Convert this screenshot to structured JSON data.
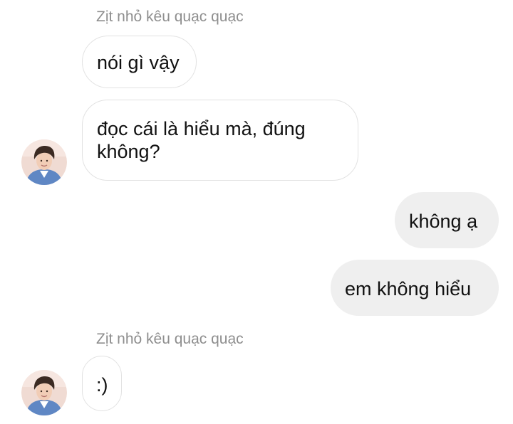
{
  "messages": [
    {
      "type": "sender",
      "text": "Zịt nhỏ kêu quạc quạc"
    },
    {
      "type": "incoming",
      "text": "nói gì vậy"
    },
    {
      "type": "incoming",
      "lines": [
        "đọc cái là hiểu mà, đúng",
        "không?"
      ],
      "avatar": "user-avatar-photo"
    },
    {
      "type": "outgoing",
      "text": "không ạ"
    },
    {
      "type": "outgoing",
      "text": "em không hiểu"
    },
    {
      "type": "sender",
      "text": "Zịt nhỏ kêu quạc quạc"
    },
    {
      "type": "incoming",
      "text": ":)",
      "avatar": "user-avatar-photo"
    }
  ],
  "colors": {
    "incoming_bubble_bg": "#ffffff",
    "incoming_bubble_border": "#e2e2e2",
    "outgoing_bubble_bg": "#efefef",
    "sender_name": "#8e8e8e",
    "text": "#111111"
  }
}
